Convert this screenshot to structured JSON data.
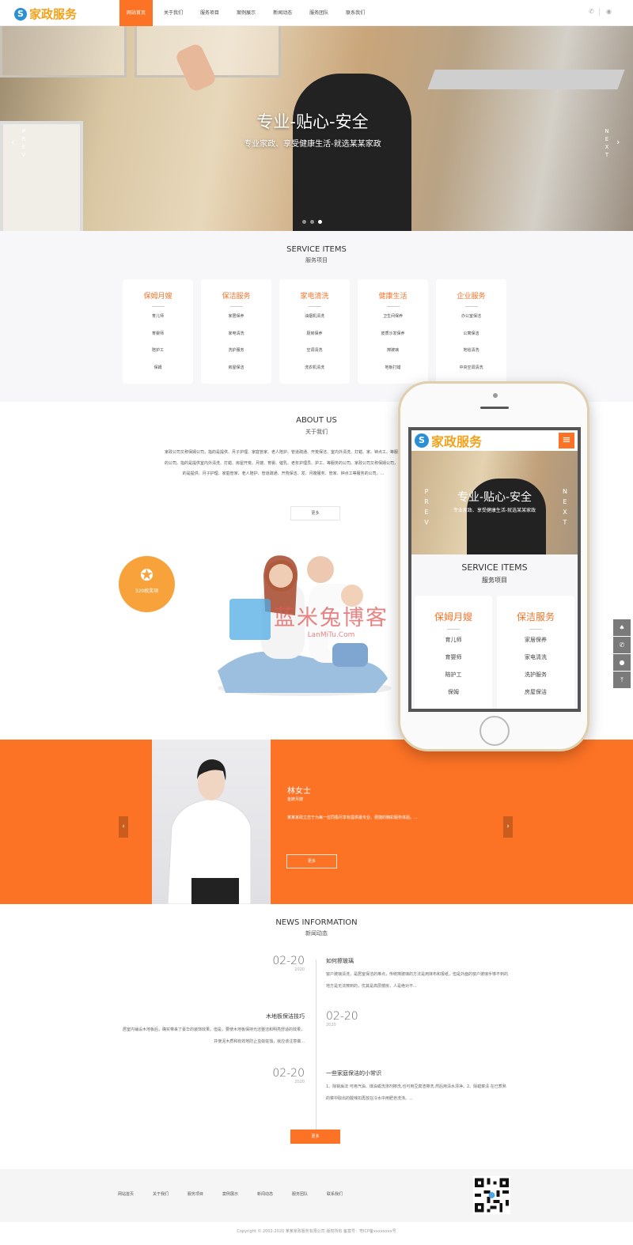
{
  "header": {
    "logo_text": "家政服务",
    "nav": [
      {
        "label": "网站首页",
        "active": true
      },
      {
        "label": "关于我们"
      },
      {
        "label": "服务项目"
      },
      {
        "label": "案例展示"
      },
      {
        "label": "新闻动态"
      },
      {
        "label": "服务团队"
      },
      {
        "label": "联系我们"
      }
    ],
    "icons": [
      "phone-icon",
      "eye-icon"
    ]
  },
  "hero": {
    "title": "专业-贴心-安全",
    "subtitle": "专业家政、享受健康生活-就选某某家政",
    "prev": "PREV",
    "next": "NEXT",
    "slides": 3,
    "active_slide": 3
  },
  "services": {
    "title": "SERVICE ITEMS",
    "subtitle": "服务项目",
    "cards": [
      {
        "title": "保姆月嫂",
        "items": [
          "育儿师",
          "育婴师",
          "陪护工",
          "保姆"
        ]
      },
      {
        "title": "保洁服务",
        "items": [
          "家居保养",
          "家电清洗",
          "洗护服务",
          "房屋保洁"
        ]
      },
      {
        "title": "家电清洗",
        "items": [
          "油烟机清洗",
          "厨房保养",
          "空调清洗",
          "洗衣机清洗"
        ]
      },
      {
        "title": "健康生活",
        "items": [
          "卫生间保养",
          "皮质沙发保养",
          "擦玻璃",
          "地板打蜡"
        ]
      },
      {
        "title": "企业服务",
        "items": [
          "办公室保洁",
          "公寓保洁",
          "地毯清洗",
          "中央空调清洗"
        ]
      }
    ]
  },
  "about": {
    "title": "ABOUT US",
    "subtitle": "关于我们",
    "text": "家政公司又称保姆公司，指的是提供、月子护理、家庭管家、老人陪护、管道疏通、开荒保洁、室内外清洗、打蜡、家、钟点工、等服务的公司。指的是提供室内外清洗、打蜡、房屋开荒、月嫂、育婴、催乳、老年护理员、护工、等服务的公司。家政公司又称保姆公司，指的是提供、月子护理、家庭管家、老人陪护、管道疏通、开荒保洁、发、月嫂服务、管家、钟点工等服务的公司。...",
    "more": "更多",
    "badge": "320枚奖项",
    "watermark": "蓝米兔博客",
    "watermark_sub": "LanMiTu.Com"
  },
  "phone_preview": {
    "logo_text": "家政服务",
    "hero_title": "专业-贴心-安全",
    "hero_subtitle": "专业家政、享受健康生活-就选某某家政",
    "prev": "PREV",
    "next": "NEXT",
    "title": "SERVICE ITEMS",
    "subtitle": "服务项目",
    "cards": [
      {
        "title": "保姆月嫂",
        "items": [
          "育儿师",
          "育婴师",
          "陪护工",
          "保姆"
        ]
      },
      {
        "title": "保洁服务",
        "items": [
          "家居保养",
          "家电清洗",
          "洗护服务",
          "房屋保洁"
        ]
      }
    ]
  },
  "testimonial": {
    "name": "林女士",
    "role": "金牌月嫂",
    "text": "某某家政立志于为每一位同极尽享有提供最专业、便捷的精彩服务体验。...",
    "more": "更多"
  },
  "news": {
    "title": "NEWS INFORMATION",
    "subtitle": "新闻动态",
    "items": [
      {
        "date": "02-20",
        "year": "2020",
        "title": "如何擦玻璃",
        "text": "窗户玻璃清洗，是居室保洁的难点，传统擦玻璃的方法是用抹布和报纸，但是外面的窗户玻璃手够不到的地方是无法擦到的，优其是高层楼房，人是绝对不..."
      },
      {
        "date": "02-20",
        "year": "2020",
        "title": "木地板保洁技巧",
        "text": "居室内铺设木地板后，确实带来了豪华的装饰效果。但是，要使木地板保持光洁整洁和明亮舒适的效果，并使泥木质和有效地防止虫蚁蛀蚀，就应该注意做..."
      },
      {
        "date": "02-20",
        "year": "2020",
        "title": "一些家庭保洁的小常识",
        "text": "1、除锅垢法 可用汽油、煤油或洗涤剂擦洗,也可用豆腐渣擦洗,然后用清水漂净。2、除蜡菜渍 在已煮熟的菜中取出的酸辣扣再放在冷水中用肥皂洗涤。..."
      }
    ],
    "more": "更多"
  },
  "footer": {
    "links": [
      "网站首页",
      "关于我们",
      "服务项目",
      "案例展示",
      "新闻动态",
      "服务团队",
      "联系我们"
    ],
    "copyright": "Copyright © 2002-2020 某某家政服务有限公司 版权所有 备案号：粤ICP备xxxxxxxx号"
  },
  "side_tools": [
    "qq-icon",
    "phone-icon",
    "wechat-icon",
    "back-to-top-icon"
  ],
  "colors": {
    "accent": "#fd7325",
    "badge": "#f7a23a",
    "logo": "#f2a21a",
    "logo_mark": "#2b8fd6"
  }
}
